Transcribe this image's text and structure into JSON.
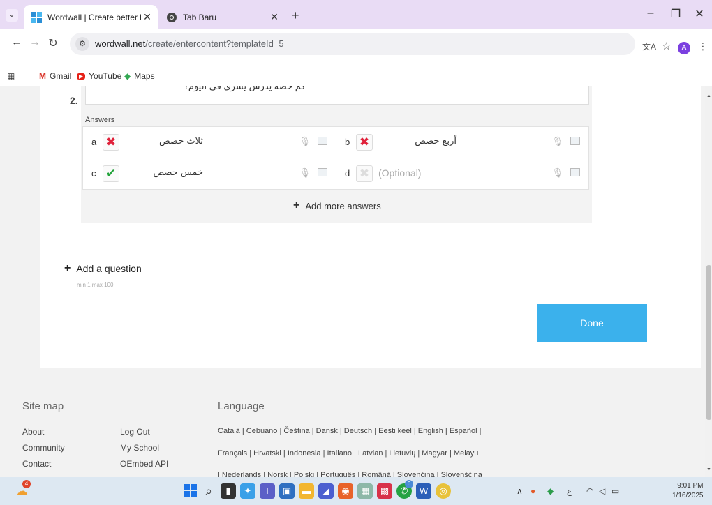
{
  "browser": {
    "tabs": [
      {
        "title": "Wordwall | Create better lesson",
        "close": "✕"
      },
      {
        "title": "Tab Baru",
        "close": "✕"
      }
    ],
    "new_tab": "+",
    "window_controls": {
      "minimize": "–",
      "restore": "❐",
      "close": "✕"
    },
    "url_host": "wordwall.net",
    "url_path": "/create/entercontent?templateId=5",
    "profile_initial": "A",
    "bookmarks": [
      "Gmail",
      "YouTube",
      "Maps"
    ]
  },
  "editor": {
    "question_number": "2.",
    "question_text": "كم حصة يدرس يسري في اليوم؟",
    "answers_label": "Answers",
    "answers": [
      {
        "letter": "a",
        "text": "ثلاث حصص",
        "state": "wrong"
      },
      {
        "letter": "b",
        "text": "أربع حصص",
        "state": "wrong"
      },
      {
        "letter": "c",
        "text": "خمس حصص",
        "state": "right"
      },
      {
        "letter": "d",
        "text": "(Optional)",
        "state": "empty"
      }
    ],
    "add_more_answers": "Add more answers",
    "add_question": "Add a question",
    "min_max": "min 1   max 100",
    "done": "Done"
  },
  "footer": {
    "site_map_heading": "Site map",
    "language_heading": "Language",
    "links_col1": [
      "About",
      "Community",
      "Contact"
    ],
    "links_col2": [
      "Log Out",
      "My School",
      "OEmbed API"
    ],
    "languages_row1": "Català | Cebuano | Čeština | Dansk | Deutsch | Eesti keel | English | Español |",
    "languages_row2": "Français | Hrvatski | Indonesia | Italiano | Latvian | Lietuvių | Magyar | Melayu",
    "languages_row3": "| Nederlands | Norsk | Polski | Português | Română | Slovenčina | Slovenščina"
  },
  "taskbar": {
    "time": "9:01 PM",
    "date": "1/16/2025",
    "weather_badge": "4",
    "whatsapp_badge": "6"
  },
  "colors": {
    "tabbar": "#e9dcf5",
    "done_button": "#3bb1ec",
    "wrong": "#e0213a",
    "right": "#22a33a"
  }
}
